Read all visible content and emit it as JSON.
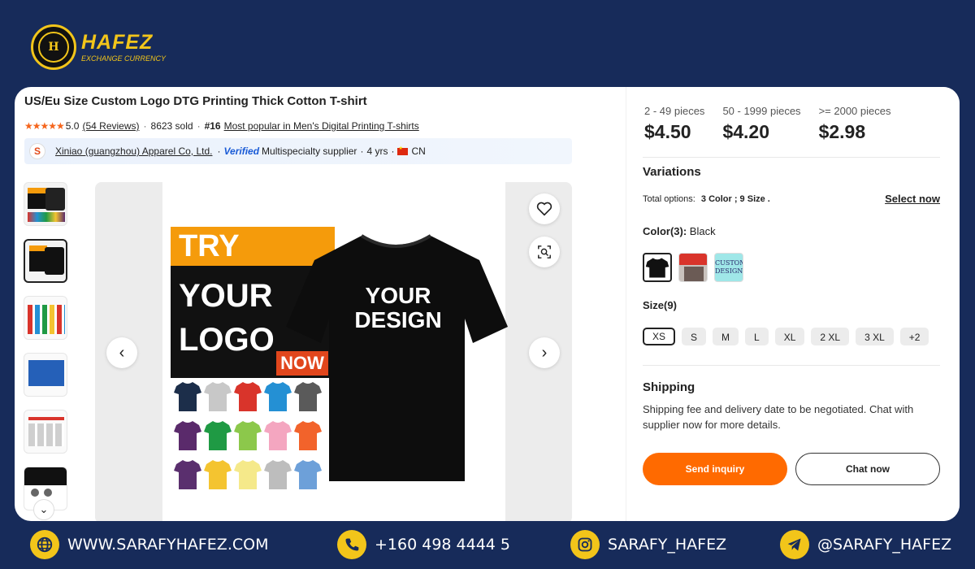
{
  "brand": {
    "name": "HAFEZ",
    "subtitle": "EXCHANGE CURRENCY",
    "seal_letter": "H",
    "accent_color": "#f2c51a",
    "background_color": "#172b5a"
  },
  "product": {
    "title": "US/Eu Size Custom Logo DTG Printing Thick Cotton T-shirt",
    "rating": "5.0",
    "reviews": "(54 Reviews)",
    "sold": "8623 sold",
    "rank": "#16",
    "rank_link": "Most popular in Men's Digital Printing T-shirts"
  },
  "supplier": {
    "logo_letter": "S",
    "name": "Xiniao (guangzhou) Apparel Co, Ltd.",
    "verified": "Verified",
    "type": "Multispecialty supplier",
    "years": "4 yrs",
    "country": "CN"
  },
  "image": {
    "try_text": "TRY",
    "your_logo_line1": "YOUR",
    "your_logo_line2": "LOGO",
    "now_text": "NOW",
    "design_line1": "YOUR",
    "design_line2": "DESIGN",
    "shirt_colors": [
      "#1c2e4a",
      "#c8c8c8",
      "#d9342b",
      "#2490d4",
      "#5a5a5a",
      "#5a2a6b",
      "#1f9a44",
      "#8cc84b",
      "#f4a6c0",
      "#f2632b",
      "#5a2f6e",
      "#f4c430",
      "#f5e98a",
      "#bdbdbd",
      "#6da0d9"
    ]
  },
  "pricing": {
    "tiers": [
      {
        "qty": "2 - 49 pieces",
        "price": "$4.50"
      },
      {
        "qty": "50 - 1999 pieces",
        "price": "$4.20"
      },
      {
        "qty": ">= 2000 pieces",
        "price": "$2.98"
      }
    ]
  },
  "variations": {
    "title": "Variations",
    "total_label": "Total options:",
    "total_value": "3 Color ; 9 Size .",
    "select_now": "Select now",
    "color_label": "Color(3):",
    "color_value": "Black",
    "custom_design_label": "CUSTOM DESIGN",
    "size_label": "Size(9)",
    "sizes": [
      "XS",
      "S",
      "M",
      "L",
      "XL",
      "2 XL",
      "3 XL",
      "+2"
    ]
  },
  "shipping": {
    "title": "Shipping",
    "text": "Shipping fee and delivery date to be negotiated. Chat with supplier now for more details."
  },
  "actions": {
    "inquiry": "Send inquiry",
    "chat": "Chat now",
    "inquiry_color": "#ff6a00"
  },
  "footer": {
    "website": "WWW.SARAFYHAFEZ.COM",
    "phone": "+160 498 4444 5",
    "instagram": "SARAFY_HAFEZ",
    "telegram": "@SARAFY_HAFEZ"
  }
}
